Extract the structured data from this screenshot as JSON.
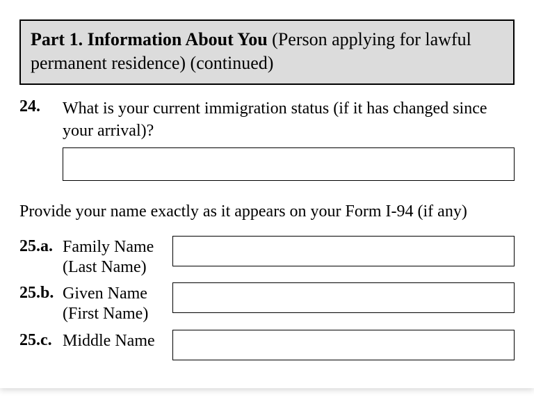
{
  "header": {
    "bold": "Part 1.  Information About You",
    "rest": " (Person applying for lawful permanent residence) (continued)"
  },
  "q24": {
    "number": "24.",
    "text": "What is your current immigration status (if it has changed since your arrival)?",
    "value": ""
  },
  "instruction": "Provide your name exactly as it appears on your Form I-94 (if any)",
  "q25a": {
    "number": "25.a.",
    "label1": "Family Name",
    "label2": "(Last Name)",
    "value": ""
  },
  "q25b": {
    "number": "25.b.",
    "label1": "Given Name",
    "label2": "(First Name)",
    "value": ""
  },
  "q25c": {
    "number": "25.c.",
    "label1": "Middle Name",
    "value": ""
  }
}
